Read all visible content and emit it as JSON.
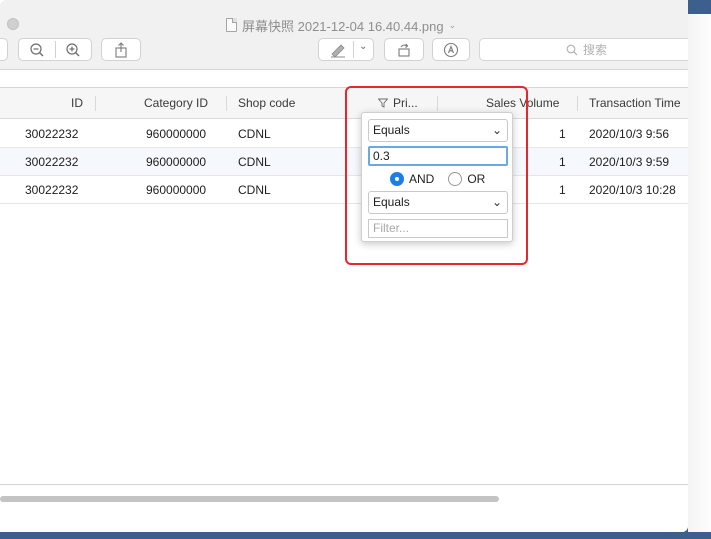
{
  "window": {
    "title": "屏幕快照 2021-12-04 16.40.44.png"
  },
  "toolbar": {
    "search_placeholder": "搜索"
  },
  "table": {
    "columns": [
      {
        "label": "ID"
      },
      {
        "label": "Category ID"
      },
      {
        "label": "Shop code"
      },
      {
        "label": "Pri..."
      },
      {
        "label": "Sales Volume"
      },
      {
        "label": "Transaction Time"
      }
    ],
    "rows": [
      {
        "id": "30022232",
        "category_id": "960000000",
        "shop_code": "CDNL",
        "sales_volume": "1",
        "transaction_time": "2020/10/3 9:56"
      },
      {
        "id": "30022232",
        "category_id": "960000000",
        "shop_code": "CDNL",
        "sales_volume": "1",
        "transaction_time": "2020/10/3 9:59"
      },
      {
        "id": "30022232",
        "category_id": "960000000",
        "shop_code": "CDNL",
        "sales_volume": "1",
        "transaction_time": "2020/10/3 10:28"
      }
    ]
  },
  "filter_popover": {
    "condition1": "Equals",
    "value1": "0.3",
    "and_label": "AND",
    "or_label": "OR",
    "selected_operator": "AND",
    "condition2": "Equals",
    "value2_placeholder": "Filter..."
  },
  "colors": {
    "highlight": "#e8262b",
    "radio_selected": "#1c7fe6",
    "desktop": "#3d5f8e"
  }
}
